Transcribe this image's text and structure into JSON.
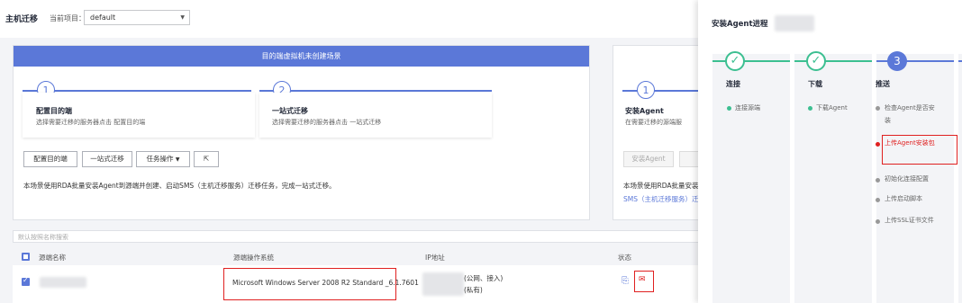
{
  "topbar": {
    "title": "主机迁移",
    "project_label": "当前项目：",
    "project_value": "default"
  },
  "scenario1": {
    "header": "目的端虚拟机未创建场景",
    "steps": [
      {
        "num": "1",
        "title": "配置目的端",
        "desc": "选择需要迁移的服务器点击 配置目的端"
      },
      {
        "num": "2",
        "title": "一站式迁移",
        "desc": "选择需要迁移的服务器点击 一站式迁移"
      }
    ],
    "buttons": {
      "config_target": "配置目的端",
      "one_stop": "一站式迁移",
      "task_ops": "任务操作"
    },
    "note": "本场景使用RDA批量安装Agent到源端并创建、启动SMS（主机迁移服务）迁移任务，完成一站式迁移。"
  },
  "scenario2": {
    "step_num": "1",
    "step_title": "安装Agent",
    "step_desc": "在需要迁移的源端服",
    "button": "安装Agent",
    "note_line1": "本场景使用RDA批量安装A",
    "note_line2": "SMS（主机迁移服务）迁"
  },
  "search": {
    "placeholder": "默认按照名称搜索"
  },
  "table": {
    "headers": {
      "name": "源端名称",
      "os": "源端操作系统",
      "ip": "IP地址",
      "status": "状态"
    },
    "row": {
      "os": "Microsoft Windows Server 2008 R2 Standard _6.1.7601",
      "ip_public": "(公网、接入)",
      "ip_private": "(私有)"
    }
  },
  "panel": {
    "title": "安装Agent进程",
    "columns": [
      {
        "title": "连接",
        "items": [
          "连接源端"
        ]
      },
      {
        "title": "下载",
        "items": [
          "下载Agent"
        ]
      },
      {
        "num": "3",
        "title": "推送",
        "items": [
          "检查Agent是否安装",
          "上传Agent安装包",
          "初始化连接配置",
          "上传启动脚本",
          "上传SSL证书文件"
        ]
      }
    ]
  },
  "colors": {
    "accent": "#5b78d8",
    "success": "#3cbf91",
    "error": "#e02020"
  }
}
